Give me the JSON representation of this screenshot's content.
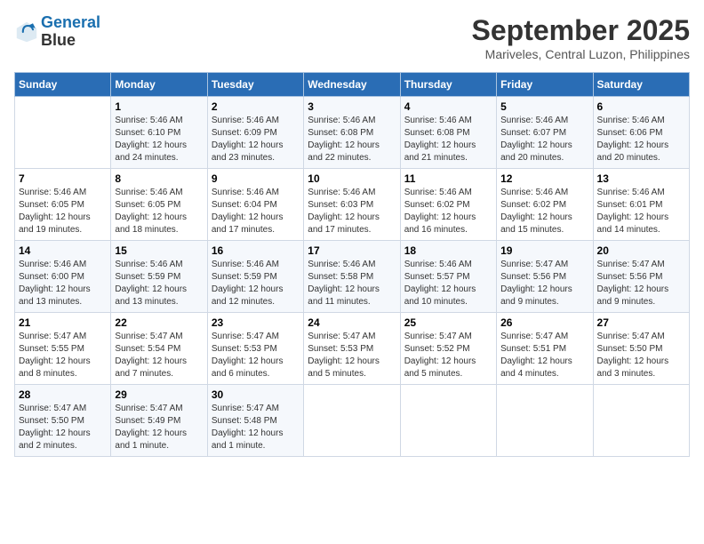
{
  "logo": {
    "line1": "General",
    "line2": "Blue"
  },
  "title": "September 2025",
  "location": "Mariveles, Central Luzon, Philippines",
  "weekdays": [
    "Sunday",
    "Monday",
    "Tuesday",
    "Wednesday",
    "Thursday",
    "Friday",
    "Saturday"
  ],
  "weeks": [
    [
      {
        "day": "",
        "detail": ""
      },
      {
        "day": "1",
        "detail": "Sunrise: 5:46 AM\nSunset: 6:10 PM\nDaylight: 12 hours\nand 24 minutes."
      },
      {
        "day": "2",
        "detail": "Sunrise: 5:46 AM\nSunset: 6:09 PM\nDaylight: 12 hours\nand 23 minutes."
      },
      {
        "day": "3",
        "detail": "Sunrise: 5:46 AM\nSunset: 6:08 PM\nDaylight: 12 hours\nand 22 minutes."
      },
      {
        "day": "4",
        "detail": "Sunrise: 5:46 AM\nSunset: 6:08 PM\nDaylight: 12 hours\nand 21 minutes."
      },
      {
        "day": "5",
        "detail": "Sunrise: 5:46 AM\nSunset: 6:07 PM\nDaylight: 12 hours\nand 20 minutes."
      },
      {
        "day": "6",
        "detail": "Sunrise: 5:46 AM\nSunset: 6:06 PM\nDaylight: 12 hours\nand 20 minutes."
      }
    ],
    [
      {
        "day": "7",
        "detail": "Sunrise: 5:46 AM\nSunset: 6:05 PM\nDaylight: 12 hours\nand 19 minutes."
      },
      {
        "day": "8",
        "detail": "Sunrise: 5:46 AM\nSunset: 6:05 PM\nDaylight: 12 hours\nand 18 minutes."
      },
      {
        "day": "9",
        "detail": "Sunrise: 5:46 AM\nSunset: 6:04 PM\nDaylight: 12 hours\nand 17 minutes."
      },
      {
        "day": "10",
        "detail": "Sunrise: 5:46 AM\nSunset: 6:03 PM\nDaylight: 12 hours\nand 17 minutes."
      },
      {
        "day": "11",
        "detail": "Sunrise: 5:46 AM\nSunset: 6:02 PM\nDaylight: 12 hours\nand 16 minutes."
      },
      {
        "day": "12",
        "detail": "Sunrise: 5:46 AM\nSunset: 6:02 PM\nDaylight: 12 hours\nand 15 minutes."
      },
      {
        "day": "13",
        "detail": "Sunrise: 5:46 AM\nSunset: 6:01 PM\nDaylight: 12 hours\nand 14 minutes."
      }
    ],
    [
      {
        "day": "14",
        "detail": "Sunrise: 5:46 AM\nSunset: 6:00 PM\nDaylight: 12 hours\nand 13 minutes."
      },
      {
        "day": "15",
        "detail": "Sunrise: 5:46 AM\nSunset: 5:59 PM\nDaylight: 12 hours\nand 13 minutes."
      },
      {
        "day": "16",
        "detail": "Sunrise: 5:46 AM\nSunset: 5:59 PM\nDaylight: 12 hours\nand 12 minutes."
      },
      {
        "day": "17",
        "detail": "Sunrise: 5:46 AM\nSunset: 5:58 PM\nDaylight: 12 hours\nand 11 minutes."
      },
      {
        "day": "18",
        "detail": "Sunrise: 5:46 AM\nSunset: 5:57 PM\nDaylight: 12 hours\nand 10 minutes."
      },
      {
        "day": "19",
        "detail": "Sunrise: 5:47 AM\nSunset: 5:56 PM\nDaylight: 12 hours\nand 9 minutes."
      },
      {
        "day": "20",
        "detail": "Sunrise: 5:47 AM\nSunset: 5:56 PM\nDaylight: 12 hours\nand 9 minutes."
      }
    ],
    [
      {
        "day": "21",
        "detail": "Sunrise: 5:47 AM\nSunset: 5:55 PM\nDaylight: 12 hours\nand 8 minutes."
      },
      {
        "day": "22",
        "detail": "Sunrise: 5:47 AM\nSunset: 5:54 PM\nDaylight: 12 hours\nand 7 minutes."
      },
      {
        "day": "23",
        "detail": "Sunrise: 5:47 AM\nSunset: 5:53 PM\nDaylight: 12 hours\nand 6 minutes."
      },
      {
        "day": "24",
        "detail": "Sunrise: 5:47 AM\nSunset: 5:53 PM\nDaylight: 12 hours\nand 5 minutes."
      },
      {
        "day": "25",
        "detail": "Sunrise: 5:47 AM\nSunset: 5:52 PM\nDaylight: 12 hours\nand 5 minutes."
      },
      {
        "day": "26",
        "detail": "Sunrise: 5:47 AM\nSunset: 5:51 PM\nDaylight: 12 hours\nand 4 minutes."
      },
      {
        "day": "27",
        "detail": "Sunrise: 5:47 AM\nSunset: 5:50 PM\nDaylight: 12 hours\nand 3 minutes."
      }
    ],
    [
      {
        "day": "28",
        "detail": "Sunrise: 5:47 AM\nSunset: 5:50 PM\nDaylight: 12 hours\nand 2 minutes."
      },
      {
        "day": "29",
        "detail": "Sunrise: 5:47 AM\nSunset: 5:49 PM\nDaylight: 12 hours\nand 1 minute."
      },
      {
        "day": "30",
        "detail": "Sunrise: 5:47 AM\nSunset: 5:48 PM\nDaylight: 12 hours\nand 1 minute."
      },
      {
        "day": "",
        "detail": ""
      },
      {
        "day": "",
        "detail": ""
      },
      {
        "day": "",
        "detail": ""
      },
      {
        "day": "",
        "detail": ""
      }
    ]
  ]
}
